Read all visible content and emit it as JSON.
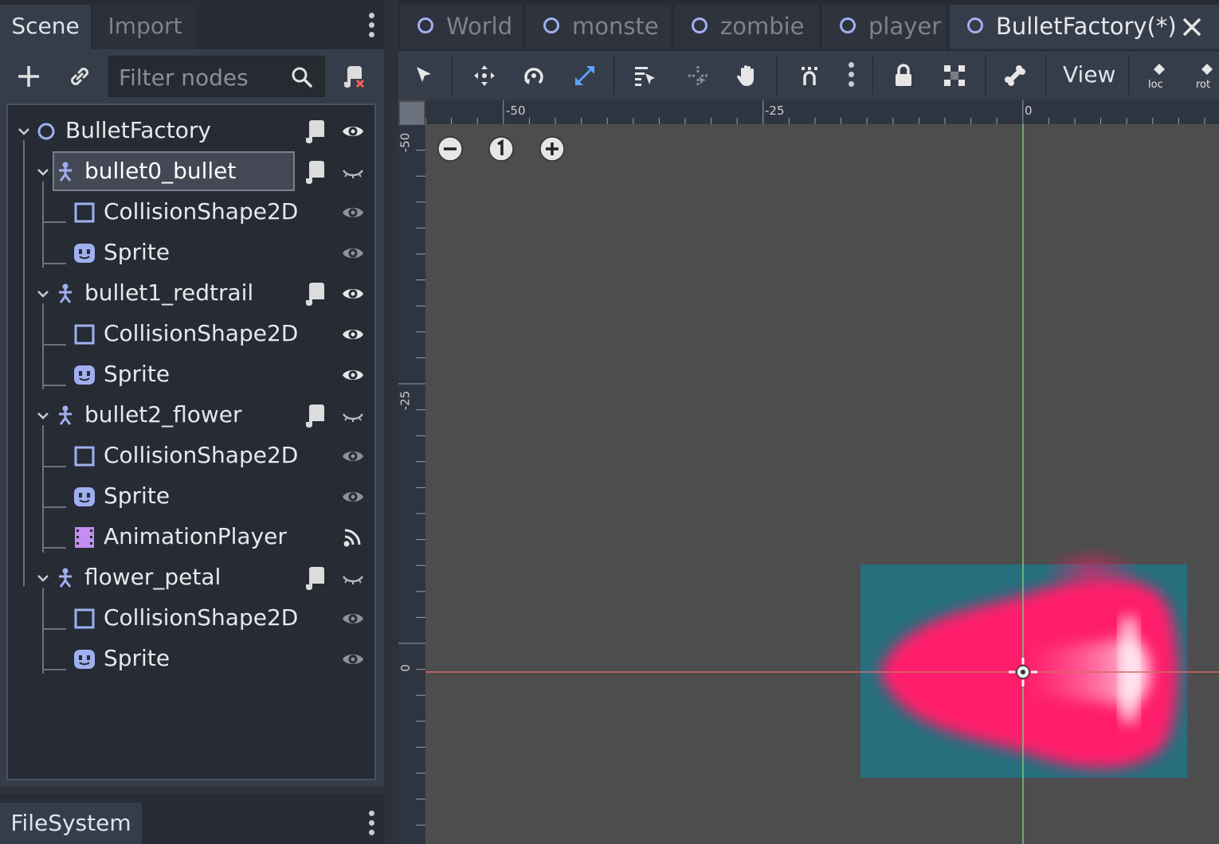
{
  "dock": {
    "tabs": [
      "Scene",
      "Import"
    ],
    "filter_placeholder": "Filter nodes",
    "filesystem_label": "FileSystem"
  },
  "tree": {
    "nodes": [
      {
        "name": "BulletFactory",
        "type": "Node2D",
        "depth": 0,
        "expanded": true,
        "script": true,
        "visibility": "visible"
      },
      {
        "name": "bullet0_bullet",
        "type": "KinematicBody2D",
        "depth": 1,
        "expanded": true,
        "script": true,
        "visibility": "hidden",
        "selected": true
      },
      {
        "name": "CollisionShape2D",
        "type": "CollisionShape2D",
        "depth": 2,
        "visibility": "visible-dim"
      },
      {
        "name": "Sprite",
        "type": "Sprite",
        "depth": 2,
        "visibility": "visible-dim"
      },
      {
        "name": "bullet1_redtrail",
        "type": "KinematicBody2D",
        "depth": 1,
        "expanded": true,
        "script": true,
        "visibility": "visible"
      },
      {
        "name": "CollisionShape2D",
        "type": "CollisionShape2D",
        "depth": 2,
        "visibility": "visible"
      },
      {
        "name": "Sprite",
        "type": "Sprite",
        "depth": 2,
        "visibility": "visible"
      },
      {
        "name": "bullet2_flower",
        "type": "KinematicBody2D",
        "depth": 1,
        "expanded": true,
        "script": true,
        "visibility": "hidden"
      },
      {
        "name": "CollisionShape2D",
        "type": "CollisionShape2D",
        "depth": 2,
        "visibility": "visible-dim"
      },
      {
        "name": "Sprite",
        "type": "Sprite",
        "depth": 2,
        "visibility": "visible-dim"
      },
      {
        "name": "AnimationPlayer",
        "type": "AnimationPlayer",
        "depth": 2,
        "visibility": "signal"
      },
      {
        "name": "flower_petal",
        "type": "KinematicBody2D",
        "depth": 1,
        "expanded": true,
        "script": true,
        "visibility": "hidden"
      },
      {
        "name": "CollisionShape2D",
        "type": "CollisionShape2D",
        "depth": 2,
        "visibility": "visible-dim"
      },
      {
        "name": "Sprite",
        "type": "Sprite",
        "depth": 2,
        "visibility": "visible-dim"
      }
    ]
  },
  "editor": {
    "tabs": [
      "World",
      "monste",
      "zombie",
      "player",
      "BulletFactory(*)"
    ],
    "active_tab": "BulletFactory(*)",
    "view_menu": "View",
    "ruler_top": [
      "-50",
      "-25",
      "0"
    ],
    "ruler_left": [
      "-50",
      "-25",
      "0"
    ]
  },
  "colors": {
    "accent_blue": "#9fb0f0",
    "tab_active_bg": "#363d4a",
    "viewport_bg": "#4d4d4d",
    "sprite_bg": "#26707e",
    "sprite_pink": "#ff1a6a",
    "axis_red": "#d46a6a",
    "axis_green": "#7fc47f"
  }
}
